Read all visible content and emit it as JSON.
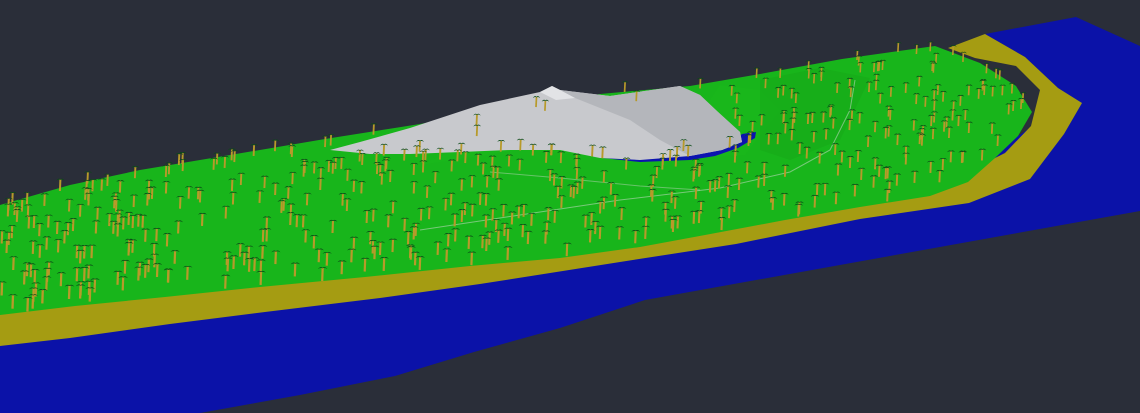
{
  "viewport": {
    "background_color": "#2a2e39",
    "description_visible_text": ""
  },
  "scene": {
    "water_color": "#0b12a8",
    "sand_color": "#a59c12",
    "grass_color": "#18b51b",
    "grass_highlight_color": "#22cc24",
    "mountain_color": "#c8c9cd",
    "mountain_shadow_color": "#a7a9ae",
    "lagoon_color": "#0c13b0",
    "path_color": "#c9d8c9",
    "tree_trunk_color": "#b79a2a",
    "tree_canopy_color": "#0b4a18",
    "tree_count": 520,
    "features": [
      "ocean",
      "beach",
      "grass-terrain",
      "mountain",
      "lagoon",
      "palm-trees",
      "footpath"
    ]
  }
}
